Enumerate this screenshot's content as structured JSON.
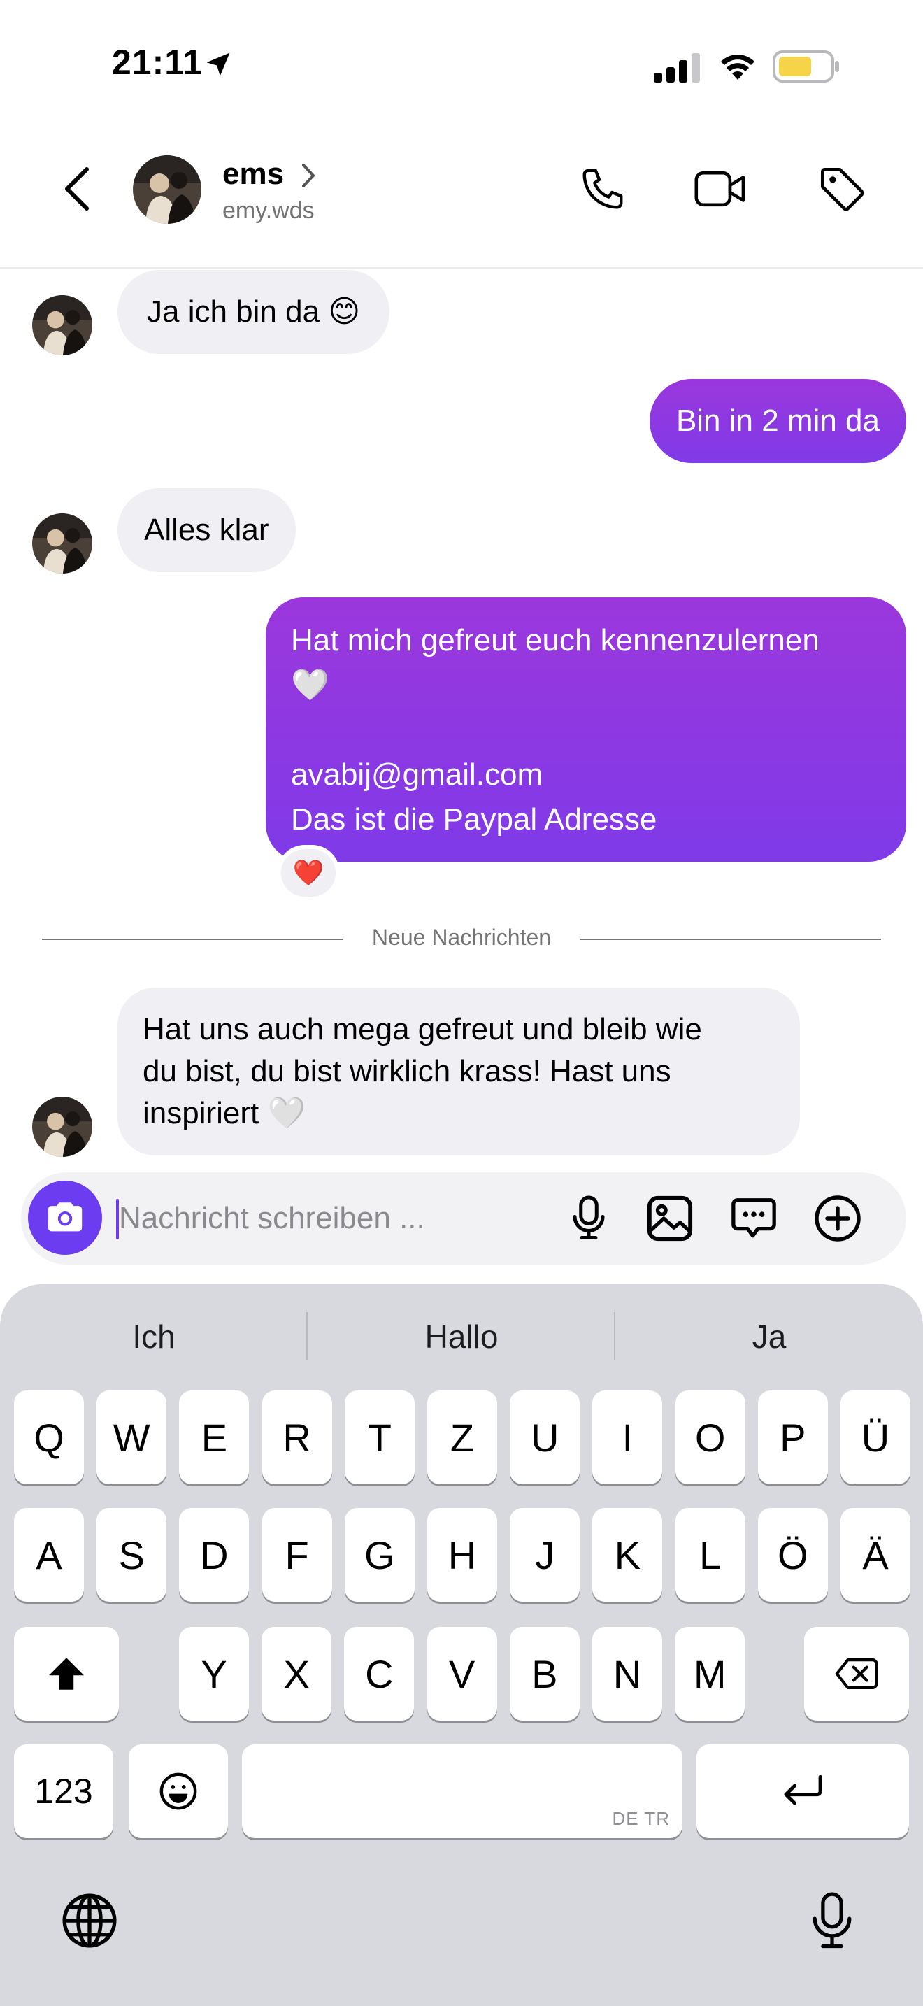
{
  "status_bar": {
    "time": "21:11"
  },
  "header": {
    "name": "ems",
    "username": "emy.wds",
    "icons": [
      "back-icon",
      "chevron-right-icon",
      "phone-icon",
      "video-camera-icon",
      "tag-icon"
    ]
  },
  "messages": [
    {
      "direction": "in",
      "text": "Ja ich bin da 😊"
    },
    {
      "direction": "out",
      "text": "Bin in 2 min da"
    },
    {
      "direction": "in",
      "text": "Alles klar"
    },
    {
      "direction": "out",
      "lines": [
        "Hat mich gefreut euch kennenzulernen",
        "🤍",
        "",
        "avabij@gmail.com",
        "Das ist die Paypal Adresse"
      ],
      "reaction": "❤️"
    }
  ],
  "divider": {
    "label": "Neue Nachrichten"
  },
  "new_messages": [
    {
      "direction": "in",
      "lines": [
        "Hat uns auch mega gefreut und bleib wie",
        "du bist, du bist wirklich krass! Hast uns",
        "inspiriert 🤍"
      ]
    }
  ],
  "composer": {
    "placeholder": "Nachricht schreiben ..."
  },
  "keyboard": {
    "suggestions": [
      "Ich",
      "Hallo",
      "Ja"
    ],
    "row1": [
      "Q",
      "W",
      "E",
      "R",
      "T",
      "Z",
      "U",
      "I",
      "O",
      "P",
      "Ü"
    ],
    "row2": [
      "A",
      "S",
      "D",
      "F",
      "G",
      "H",
      "J",
      "K",
      "L",
      "Ö",
      "Ä"
    ],
    "row3": [
      "Y",
      "X",
      "C",
      "V",
      "B",
      "N",
      "M"
    ],
    "numbers_label": "123",
    "space_tag": "DE TR"
  },
  "colors": {
    "accent": "#6b3cf0",
    "outgoing_top": "#9b37dc",
    "outgoing_bottom": "#7f3ae8",
    "incoming": "#efeff4",
    "battery": "#f5d44a"
  }
}
